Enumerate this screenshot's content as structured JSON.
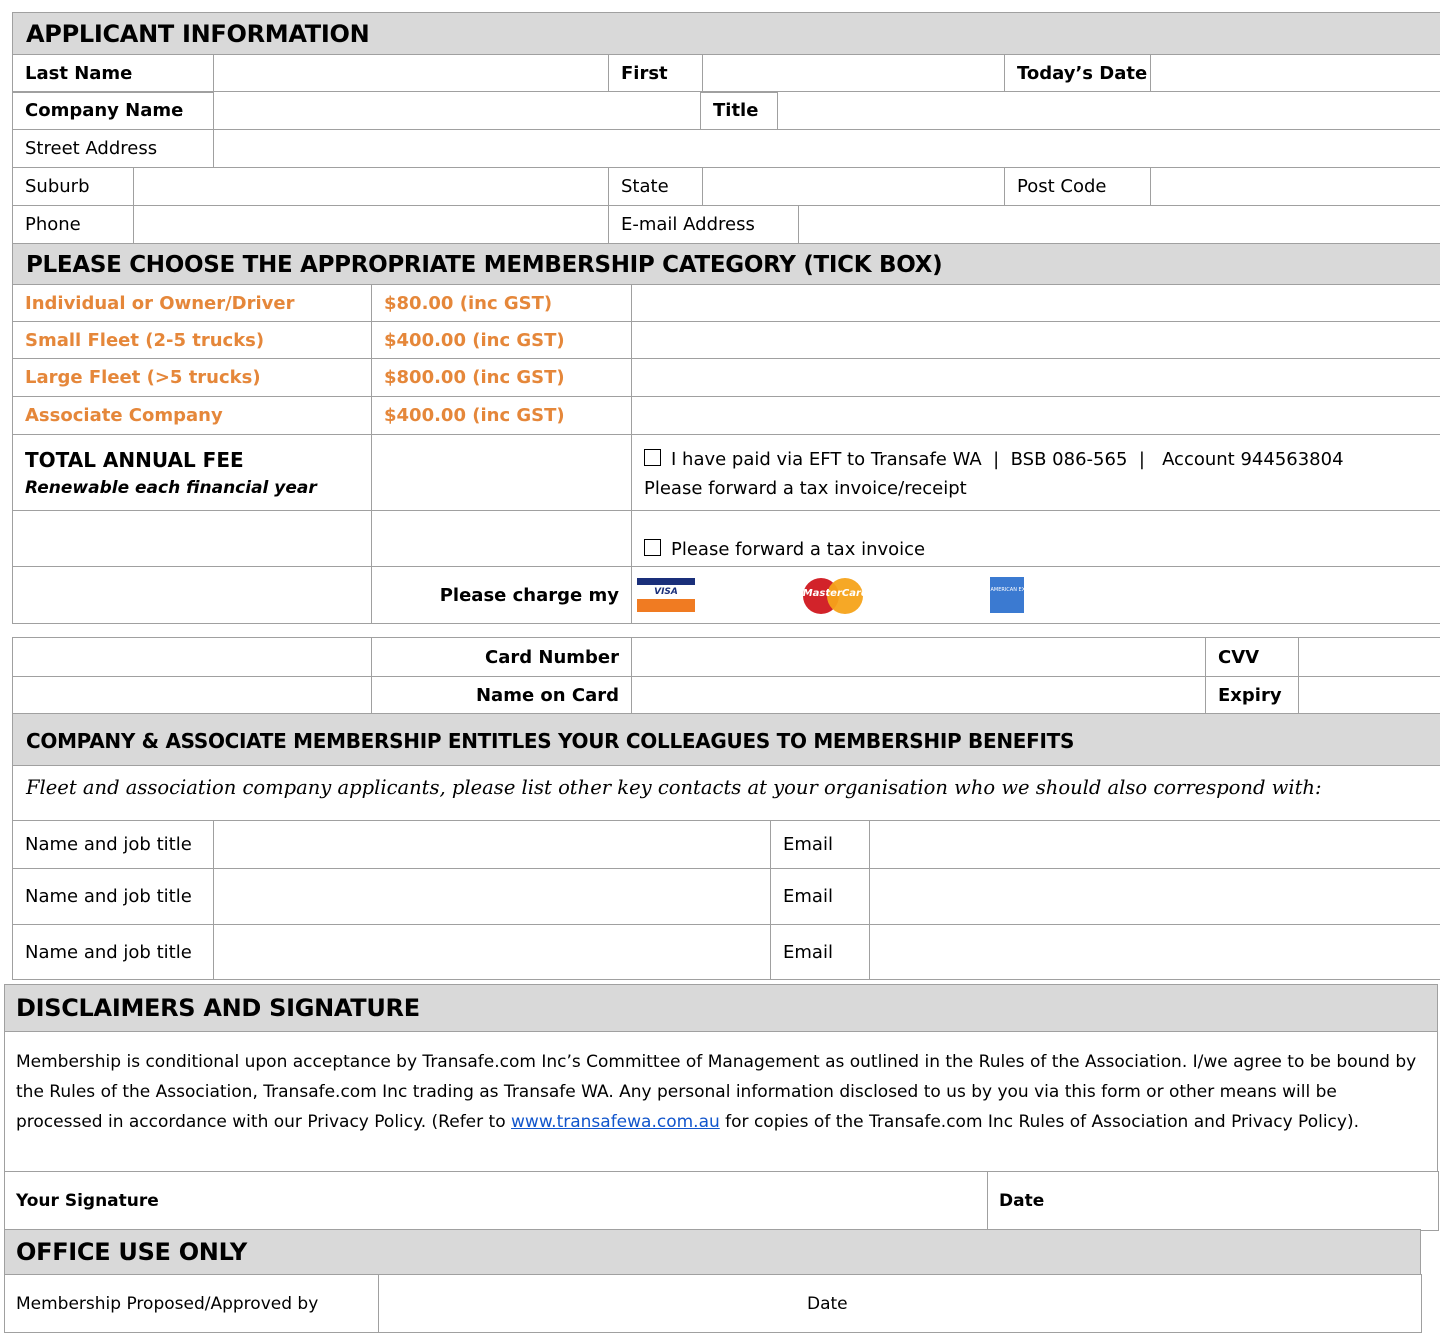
{
  "applicant": {
    "heading": "APPLICANT INFORMATION",
    "last_name_label": "Last Name",
    "first_label": "First",
    "todays_date_label": "Today’s Date",
    "company_name_label": "Company Name",
    "title_label": "Title",
    "street_address_label": "Street Address",
    "suburb_label": "Suburb",
    "state_label": "State",
    "post_code_label": "Post Code",
    "phone_label": "Phone",
    "email_label": "E-mail Address"
  },
  "membership": {
    "heading": "PLEASE CHOOSE THE APPROPRIATE MEMBERSHIP CATEGORY (TICK BOX)",
    "categories": [
      {
        "name": "Individual or Owner/Driver",
        "price": "$80.00 (inc GST)"
      },
      {
        "name": "Small Fleet (2-5 trucks)",
        "price": "$400.00 (inc GST)"
      },
      {
        "name": "Large Fleet (>5 trucks)",
        "price": "$800.00 (inc GST)"
      },
      {
        "name": "Associate Company",
        "price": "$400.00 (inc GST)"
      }
    ],
    "total_label": "TOTAL ANNUAL FEE",
    "renewable_note": "Renewable each financial year",
    "eft_option": "I have paid via EFT to Transafe WA  |  BSB 086-565  |   Account 944563804",
    "eft_followup": "Please forward a tax invoice/receipt",
    "invoice_option": "Please forward a tax invoice",
    "charge_label": "Please charge my",
    "card_logos": {
      "visa": "VISA",
      "mastercard": "MasterCard",
      "amex": "AMERICAN EXPRESS"
    },
    "card_number_label": "Card Number",
    "cvv_label": "CVV",
    "name_on_card_label": "Name on Card",
    "expiry_label": "Expiry"
  },
  "colleagues": {
    "heading": "COMPANY & ASSOCIATE MEMBERSHIP ENTITLES YOUR COLLEAGUES TO MEMBERSHIP BENEFITS",
    "intro": "Fleet and association company applicants, please list other key contacts at your organisation who we should also correspond with:",
    "rows": [
      {
        "name_label": "Name and job title",
        "email_label": "Email"
      },
      {
        "name_label": "Name and job title",
        "email_label": "Email"
      },
      {
        "name_label": "Name and job title",
        "email_label": "Email"
      }
    ]
  },
  "disclaimer": {
    "heading": "DISCLAIMERS AND SIGNATURE",
    "text_before_link": "Membership is conditional upon acceptance by Transafe.com Inc’s Committee of Management as outlined in the Rules of the Association. I/we agree to be bound by the Rules of the Association, Transafe.com Inc trading as Transafe WA. Any personal information disclosed to us by you via this form or other means will be processed in accordance with our Privacy Policy. (Refer to ",
    "link_text": "www.transafewa.com.au",
    "text_after_link": " for copies of the Transafe.com Inc Rules of Association and Privacy Policy).",
    "signature_label": "Your Signature",
    "date_label": "Date"
  },
  "office": {
    "heading": "OFFICE USE ONLY",
    "approved_label": "Membership Proposed/Approved by",
    "date_label": "Date"
  },
  "colors": {
    "band": "#d9d9d9",
    "category_text": "#e5873a",
    "border": "#a0a0a0",
    "link": "#1155cc"
  }
}
